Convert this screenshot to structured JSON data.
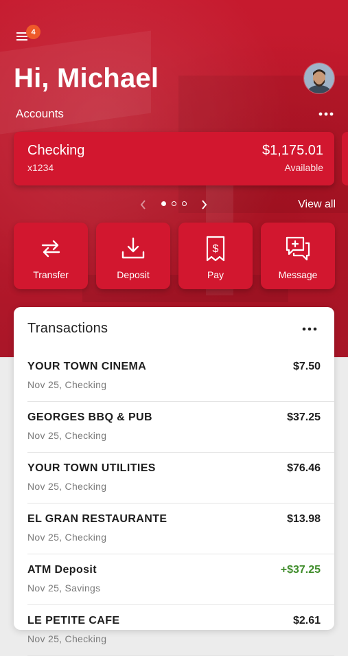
{
  "header": {
    "menu_icon": "hamburger-menu-icon",
    "notification_count": "4",
    "greeting": "Hi, Michael",
    "avatar_icon": "user-avatar"
  },
  "accounts": {
    "label": "Accounts",
    "more_icon": "ellipsis-icon",
    "card": {
      "name": "Checking",
      "number": "x1234",
      "balance": "$1,175.01",
      "balance_label": "Available"
    },
    "pager": {
      "pages": 3,
      "active_index": 0
    },
    "view_all": "View all"
  },
  "actions": [
    {
      "label": "Transfer",
      "icon": "transfer-arrows-icon"
    },
    {
      "label": "Deposit",
      "icon": "deposit-download-icon"
    },
    {
      "label": "Pay",
      "icon": "pay-receipt-icon"
    },
    {
      "label": "Message",
      "icon": "message-chat-icon"
    }
  ],
  "transactions": {
    "title": "Transactions",
    "more_icon": "ellipsis-icon",
    "items": [
      {
        "name": "YOUR TOWN CINEMA",
        "detail": "Nov 25, Checking",
        "amount": "$7.50",
        "credit": false
      },
      {
        "name": "GEORGES BBQ & PUB",
        "detail": "Nov 25, Checking",
        "amount": "$37.25",
        "credit": false
      },
      {
        "name": "YOUR TOWN UTILITIES",
        "detail": "Nov 25, Checking",
        "amount": "$76.46",
        "credit": false
      },
      {
        "name": "EL GRAN RESTAURANTE",
        "detail": "Nov 25, Checking",
        "amount": "$13.98",
        "credit": false
      },
      {
        "name": "ATM Deposit",
        "detail": "Nov 25, Savings",
        "amount": "+$37.25",
        "credit": true
      },
      {
        "name": "LE PETITE CAFE",
        "detail": "Nov 25, Checking",
        "amount": "$2.61",
        "credit": false
      }
    ]
  },
  "colors": {
    "brand_red": "#c61a2e",
    "card_red": "#d2172f",
    "badge_orange": "#ee5a2a",
    "credit_green": "#3e8c2a"
  }
}
